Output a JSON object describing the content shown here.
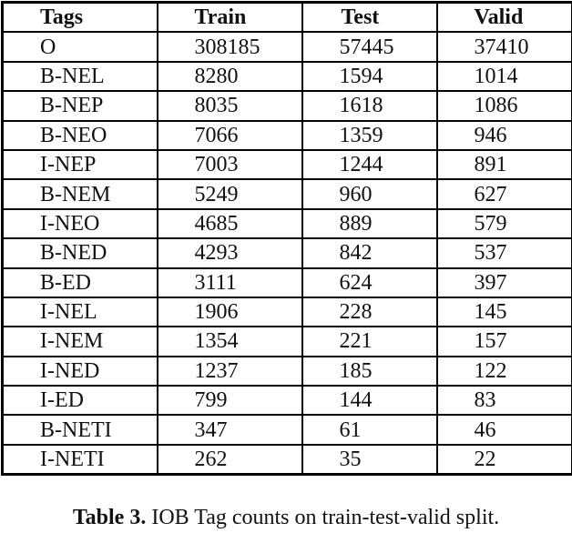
{
  "table": {
    "headers": [
      "Tags",
      "Train",
      "Test",
      "Valid"
    ],
    "rows": [
      {
        "tag": "O",
        "train": "308185",
        "test": "57445",
        "valid": "37410"
      },
      {
        "tag": "B-NEL",
        "train": "8280",
        "test": "1594",
        "valid": "1014"
      },
      {
        "tag": "B-NEP",
        "train": "8035",
        "test": "1618",
        "valid": "1086"
      },
      {
        "tag": "B-NEO",
        "train": "7066",
        "test": "1359",
        "valid": "946"
      },
      {
        "tag": "I-NEP",
        "train": "7003",
        "test": "1244",
        "valid": "891"
      },
      {
        "tag": "B-NEM",
        "train": "5249",
        "test": "960",
        "valid": "627"
      },
      {
        "tag": "I-NEO",
        "train": "4685",
        "test": "889",
        "valid": "579"
      },
      {
        "tag": "B-NED",
        "train": "4293",
        "test": "842",
        "valid": "537"
      },
      {
        "tag": "B-ED",
        "train": "3111",
        "test": "624",
        "valid": "397"
      },
      {
        "tag": "I-NEL",
        "train": "1906",
        "test": "228",
        "valid": "145"
      },
      {
        "tag": "I-NEM",
        "train": "1354",
        "test": "221",
        "valid": "157"
      },
      {
        "tag": "I-NED",
        "train": "1237",
        "test": "185",
        "valid": "122"
      },
      {
        "tag": "I-ED",
        "train": "799",
        "test": "144",
        "valid": "83"
      },
      {
        "tag": "B-NETI",
        "train": "347",
        "test": "61",
        "valid": "46"
      },
      {
        "tag": "I-NETI",
        "train": "262",
        "test": "35",
        "valid": "22"
      }
    ]
  },
  "caption": {
    "label": "Table 3.",
    "text": " IOB Tag counts on train-test-valid split."
  }
}
